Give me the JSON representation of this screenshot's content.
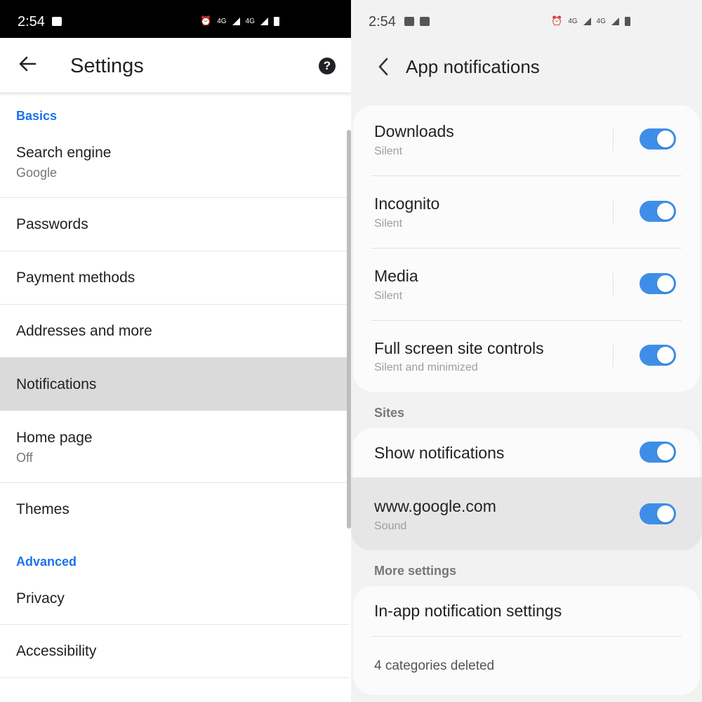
{
  "left": {
    "status": {
      "time": "2:54",
      "net1": "4G",
      "net2": "4G"
    },
    "header": {
      "title": "Settings",
      "help": "?"
    },
    "sections": {
      "basics": "Basics",
      "advanced": "Advanced"
    },
    "items": [
      {
        "label": "Search engine",
        "sub": "Google"
      },
      {
        "label": "Passwords"
      },
      {
        "label": "Payment methods"
      },
      {
        "label": "Addresses and more"
      },
      {
        "label": "Notifications",
        "selected": true
      },
      {
        "label": "Home page",
        "sub": "Off"
      },
      {
        "label": "Themes"
      },
      {
        "label": "Privacy"
      },
      {
        "label": "Accessibility"
      }
    ]
  },
  "right": {
    "status": {
      "time": "2:54",
      "net1": "4G",
      "net2": "4G"
    },
    "header": {
      "title": "App notifications"
    },
    "categories": [
      {
        "label": "Downloads",
        "sub": "Silent",
        "on": true
      },
      {
        "label": "Incognito",
        "sub": "Silent",
        "on": true
      },
      {
        "label": "Media",
        "sub": "Silent",
        "on": true
      },
      {
        "label": "Full screen site controls",
        "sub": "Silent and minimized",
        "on": true
      }
    ],
    "sites_label": "Sites",
    "sites": [
      {
        "label": "Show notifications",
        "on": true
      },
      {
        "label": "www.google.com",
        "sub": "Sound",
        "on": true
      }
    ],
    "more_label": "More settings",
    "more": {
      "inapp": "In-app notification settings",
      "deleted": "4 categories deleted"
    }
  },
  "colors": {
    "accent_blue": "#1a73e8",
    "toggle_on": "#3e8ee9",
    "selected_row": "#dadada"
  }
}
